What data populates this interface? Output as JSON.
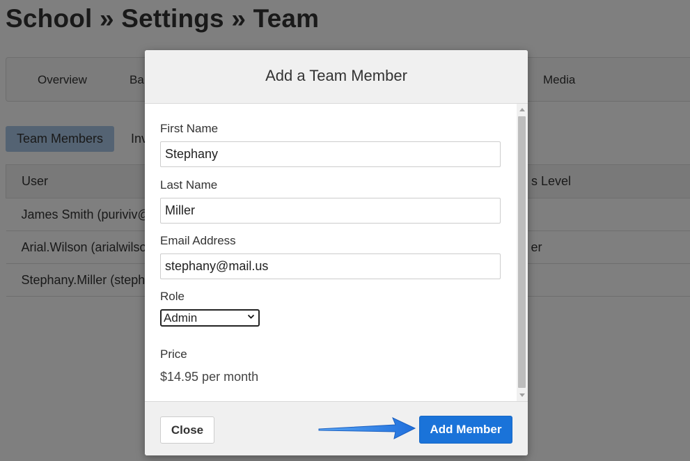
{
  "page": {
    "title": "School » Settings » Team"
  },
  "main_nav": {
    "items": [
      "Overview",
      "Ba",
      "Media"
    ]
  },
  "sub_tabs": {
    "items": [
      "Team Members",
      "Inv"
    ]
  },
  "team_table": {
    "headers": [
      "User",
      "s Level"
    ],
    "rows": [
      [
        "James Smith (puriviv@",
        ""
      ],
      [
        "Arial.Wilson (arialwilso",
        "er"
      ],
      [
        "Stephany.Miller (steph",
        ""
      ]
    ]
  },
  "modal": {
    "title": "Add a Team Member",
    "first_name": {
      "label": "First Name",
      "value": "Stephany"
    },
    "last_name": {
      "label": "Last Name",
      "value": "Miller"
    },
    "email": {
      "label": "Email Address",
      "value": "stephany@mail.us"
    },
    "role": {
      "label": "Role",
      "value": "Admin"
    },
    "price": {
      "label": "Price",
      "value": "$14.95 per month"
    },
    "close_label": "Close",
    "add_label": "Add Member"
  },
  "colors": {
    "primary_button": "#1a73d9",
    "active_tab": "#a9c7e6",
    "annotation_arrow": "#1f7ae0",
    "overlay": "rgba(0,0,0,0.5)"
  },
  "icons": {
    "select_chevron": "chevron-down-icon",
    "scroll_up": "scroll-up-arrow-icon",
    "scroll_down": "scroll-down-arrow-icon",
    "annotation": "pointer-arrow-icon"
  }
}
